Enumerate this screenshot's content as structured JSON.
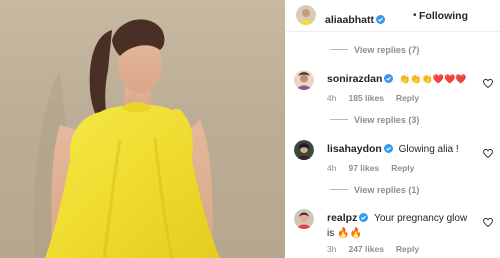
{
  "post": {
    "author": "aliaabhatt",
    "follow_label": "Following",
    "follow_separator": "•"
  },
  "comments": [
    {
      "view_replies_above": "View replies (7)"
    },
    {
      "username": "sonirazdan",
      "text": "👏👏👏❤️❤️❤️",
      "time": "4h",
      "likes": "185 likes",
      "reply_label": "Reply",
      "verified": true,
      "view_replies": "View replies (3)"
    },
    {
      "username": "lisahaydon",
      "text": "Glowing alia !",
      "time": "4h",
      "likes": "97 likes",
      "reply_label": "Reply",
      "verified": true,
      "view_replies": "View replies (1)"
    },
    {
      "username": "realpz",
      "text": "Your pregnancy glow is 🔥🔥",
      "time": "3h",
      "likes": "247 likes",
      "reply_label": "Reply",
      "verified": true
    }
  ],
  "colors": {
    "verified_blue": "#3897f0",
    "muted_text": "#8e8e8e",
    "dress_yellow": "#f2e23a",
    "photo_background": "#c2b49c"
  },
  "icons": {
    "verified": "verified-badge-icon",
    "like": "heart-outline-icon"
  }
}
